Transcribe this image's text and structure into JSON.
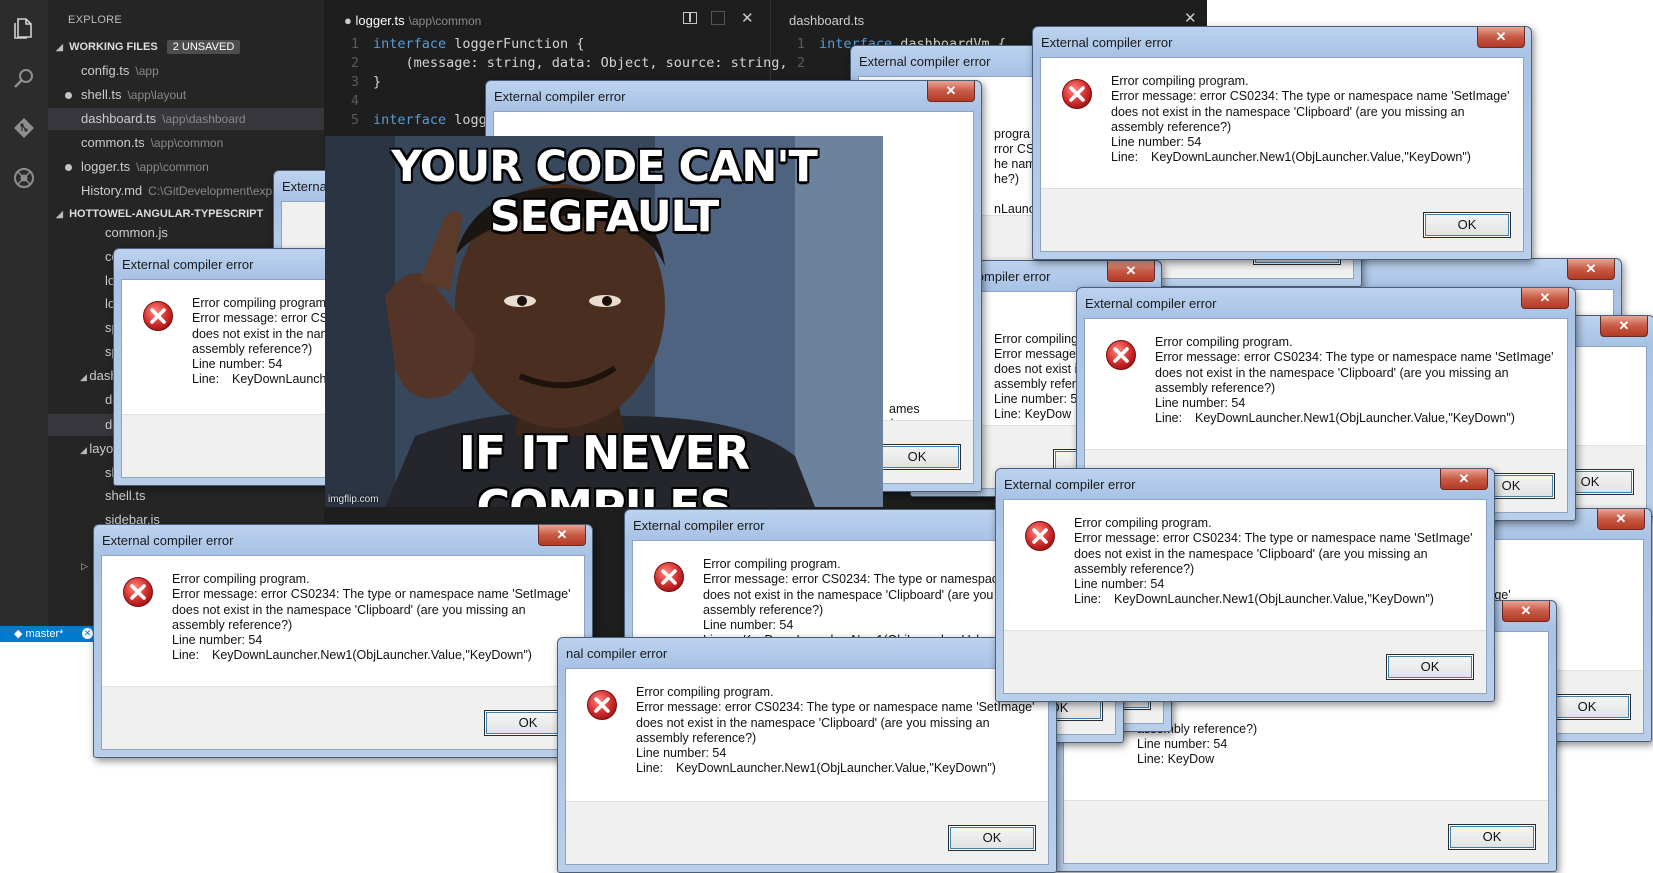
{
  "editor": {
    "explorer_title": "EXPLORE",
    "working_files_label": "WORKING FILES",
    "unsaved_badge": "2 UNSAVED",
    "working_files": [
      {
        "name": "config.ts",
        "path": "\\app",
        "modified": false,
        "selected": false
      },
      {
        "name": "shell.ts",
        "path": "\\app\\layout",
        "modified": true,
        "selected": false
      },
      {
        "name": "dashboard.ts",
        "path": "\\app\\dashboard",
        "modified": false,
        "selected": true
      },
      {
        "name": "common.ts",
        "path": "\\app\\common",
        "modified": false,
        "selected": false
      },
      {
        "name": "logger.ts",
        "path": "\\app\\common",
        "modified": true,
        "selected": false
      },
      {
        "name": "History.md",
        "path": "C:\\GitDevelopment\\exp",
        "modified": false,
        "selected": false
      }
    ],
    "project_label": "HOTTOWEL-ANGULAR-TYPESCRIPT",
    "tree": {
      "common_js": "common.js",
      "co": "co",
      "lo1": "lo",
      "lo2": "lo",
      "sp1": "sp",
      "sp2": "sp",
      "dashboard_folder": "dash",
      "da1": "da",
      "da2": "da",
      "layout_folder": "layo",
      "sh": "sh",
      "shell_ts": "shell.ts",
      "sidebar_js": "sidebar.js"
    },
    "status_branch": "master*",
    "left_tab": {
      "title": "logger.ts",
      "path": "\\app\\common",
      "dirty_marker": "●"
    },
    "right_tab": {
      "title": "dashboard.ts"
    },
    "close_glyph": "✕",
    "left_code": [
      {
        "n": "1",
        "kw": "interface",
        "rest": " loggerFunction {"
      },
      {
        "n": "2",
        "kw": "",
        "rest": "    (message: string, data: Object, source: string,"
      },
      {
        "n": "3",
        "kw": "",
        "rest": "}"
      },
      {
        "n": "4",
        "kw": "",
        "rest": ""
      },
      {
        "n": "5",
        "kw": "interface",
        "rest": " logg"
      }
    ],
    "right_code": [
      {
        "n": "1",
        "kw": "interface",
        "rest": " dashboardVm {"
      },
      {
        "n": "2",
        "kw": "",
        "rest": ""
      }
    ]
  },
  "dialog": {
    "title": "External compiler error",
    "close": "✕",
    "line1": "Error compiling program.",
    "line2": "Error message:  error CS0234: The type or namespace name 'SetImage'",
    "line3": "does not exist in the namespace 'Clipboard' (are you missing an",
    "line4": "assembly reference?)",
    "line5": "Line number: 54",
    "line6_label": "Line:",
    "line6_value": "KeyDownLauncher.New1(ObjLauncher.Value,\"KeyDown\")",
    "ok": "OK",
    "partial_title": "nal compiler error",
    "partial_title2": "External",
    "frag_ames": "ames",
    "frag_ar": "(ar",
    "frag_herv": "her.V",
    "frag_ob": "(ObjL",
    "frag_e": "e'",
    "frag_progra": "progra",
    "frag_rror": "rror CS0",
    "frag_name": "he nam",
    "frag_e2": "he?)",
    "frag_launch": "nLaunche",
    "frag_errp": "Error compiling p",
    "frag_errm": "Error message:  e",
    "frag_doesn": "does not exist in",
    "frag_assemr": "assembly referen",
    "frag_line54": "Line number: 54",
    "frag_linekd": "Line:     KeyDow",
    "frag_setimage": "ace name 'SetImage'",
    "frag_missing": "ou missing an",
    "frag_keydown": "lue,\"KeyDown\")",
    "frag_erro": "Erro",
    "frag_does": "does",
    "frag_assembly_ref": "assembly reference?)"
  },
  "meme": {
    "top_text": "YOUR CODE CAN'T SEGFAULT",
    "bottom_text": "IF IT NEVER COMPILES",
    "watermark": "imgflip.com"
  },
  "colors": {
    "editor_bg": "#1e1e1e",
    "sidebar_bg": "#252526",
    "status_blue": "#007acc",
    "error_red": "#d32f2f"
  }
}
